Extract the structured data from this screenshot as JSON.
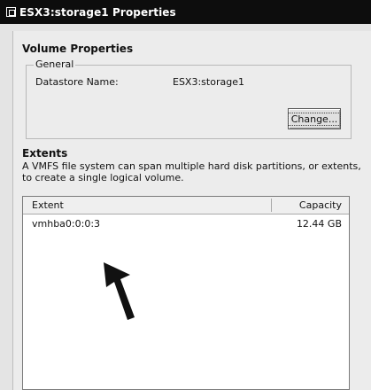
{
  "window": {
    "title": "ESX3:storage1 Properties"
  },
  "volume_properties": {
    "heading": "Volume Properties",
    "group_label": "General",
    "datastore_name_label": "Datastore Name:",
    "datastore_name_value": "ESX3:storage1",
    "change_button_label": "Change..."
  },
  "extents": {
    "heading": "Extents",
    "description": "A VMFS file system can span multiple hard disk partitions, or extents, to create a single logical volume.",
    "columns": [
      "Extent",
      "Capacity"
    ],
    "rows": [
      {
        "extent": "vmhba0:0:0:3",
        "capacity": "12.44 GB"
      }
    ]
  },
  "annotation": {
    "icon": "arrow-pointer-icon",
    "color": "#111111"
  }
}
